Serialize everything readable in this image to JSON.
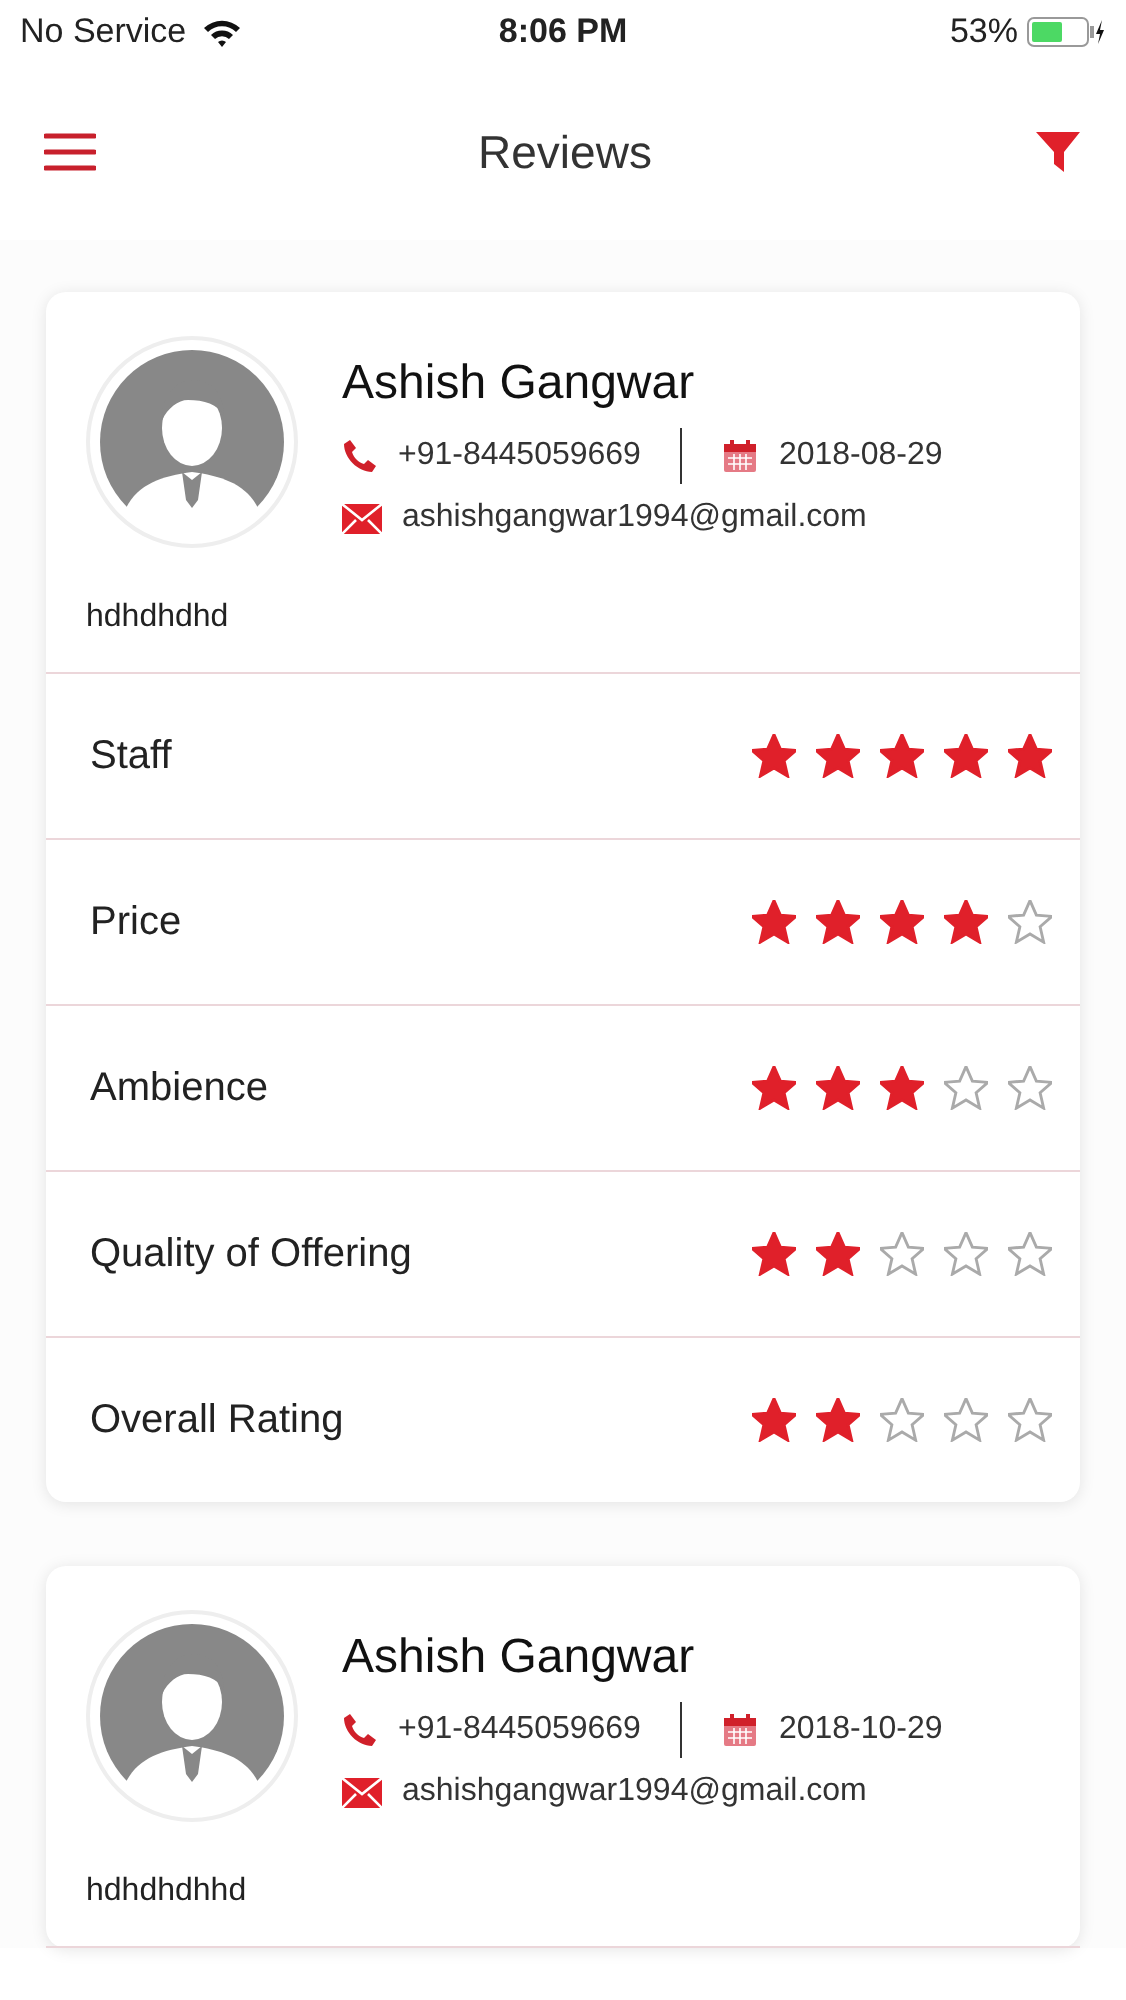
{
  "status_bar": {
    "carrier": "No Service",
    "time": "8:06 PM",
    "battery": "53%"
  },
  "header": {
    "title": "Reviews"
  },
  "reviews": [
    {
      "name": "Ashish Gangwar",
      "phone": "+91-8445059669",
      "date": "2018-08-29",
      "email": "ashishgangwar1994@gmail.com",
      "comment": "hdhdhdhd",
      "ratings": [
        {
          "label": "Staff",
          "stars": 5
        },
        {
          "label": "Price",
          "stars": 4
        },
        {
          "label": "Ambience",
          "stars": 3
        },
        {
          "label": "Quality of Offering",
          "stars": 2
        },
        {
          "label": "Overall Rating",
          "stars": 2
        }
      ]
    },
    {
      "name": "Ashish Gangwar",
      "phone": "+91-8445059669",
      "date": "2018-10-29",
      "email": "ashishgangwar1994@gmail.com",
      "comment": "hdhdhdhhd"
    }
  ]
}
